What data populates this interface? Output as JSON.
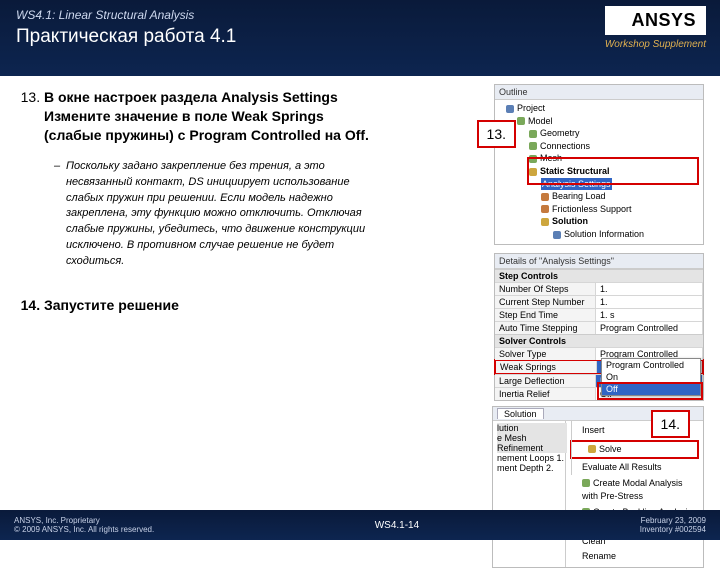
{
  "header": {
    "chapter": "WS4.1: Linear Structural Analysis",
    "title": "Практическая работа 4.1",
    "logo": "ANSYS",
    "supplement": "Workshop Supplement"
  },
  "steps": {
    "n13": "13.",
    "n14": "14.",
    "s13": "В окне настроек раздела Analysis Settings Измените значение в поле Weak Springs (слабые пружины) с Program Controlled на Off.",
    "s13_sub": "Поскольку задано закрепление без трения, а это несвязанный контакт, DS инициирует использование слабых пружин при решении. Если модель надежно закреплена, эту функцию можно отключить. Отключая слабые пружины, убедитесь, что движение конструкции исключено. В противном случае решение не будет сходиться.",
    "s14": "Запустите решение"
  },
  "outline": {
    "title": "Outline",
    "root": "Project",
    "model": "Model",
    "items": [
      "Geometry",
      "Connections",
      "Mesh"
    ],
    "static": "Static Structural",
    "analysis": "Analysis Settings",
    "loads": [
      "Bearing Load",
      "Frictionless Support"
    ],
    "sol": "Solution",
    "solinfo": "Solution Information"
  },
  "details": {
    "title": "Details of \"Analysis Settings\"",
    "g1": "Step Controls",
    "rows1": [
      [
        "Number Of Steps",
        "1."
      ],
      [
        "Current Step Number",
        "1."
      ],
      [
        "Step End Time",
        "1. s"
      ],
      [
        "Auto Time Stepping",
        "Program Controlled"
      ]
    ],
    "g2": "Solver Controls",
    "rows2": [
      [
        "Solver Type",
        "Program Controlled"
      ],
      [
        "Weak Springs",
        "Program Controlled"
      ],
      [
        "Large Deflection",
        "Program Controlled"
      ],
      [
        "Inertia Relief",
        "Off"
      ]
    ],
    "dropdown": [
      "Program Controlled",
      "On",
      "Off"
    ]
  },
  "ctx": {
    "tab": "Solution",
    "insert": "Insert",
    "solve": "Solve",
    "eval": "Evaluate All Results",
    "lution": "lution",
    "mesh": "e Mesh Refinement",
    "loops": "nement Loops   1.",
    "depth": "ment Depth   2.",
    "extras": [
      "Create Modal Analysis with Pre-Stress",
      "Create Buckling Analysis with Pre-Stress",
      "Clean",
      "Rename"
    ]
  },
  "callouts": {
    "c13": "13.",
    "c14": "14."
  },
  "footer": {
    "l1": "ANSYS, Inc. Proprietary",
    "l2": "© 2009 ANSYS, Inc.  All rights reserved.",
    "center": "WS4.1-14",
    "r1": "February 23, 2009",
    "r2": "Inventory #002594"
  }
}
